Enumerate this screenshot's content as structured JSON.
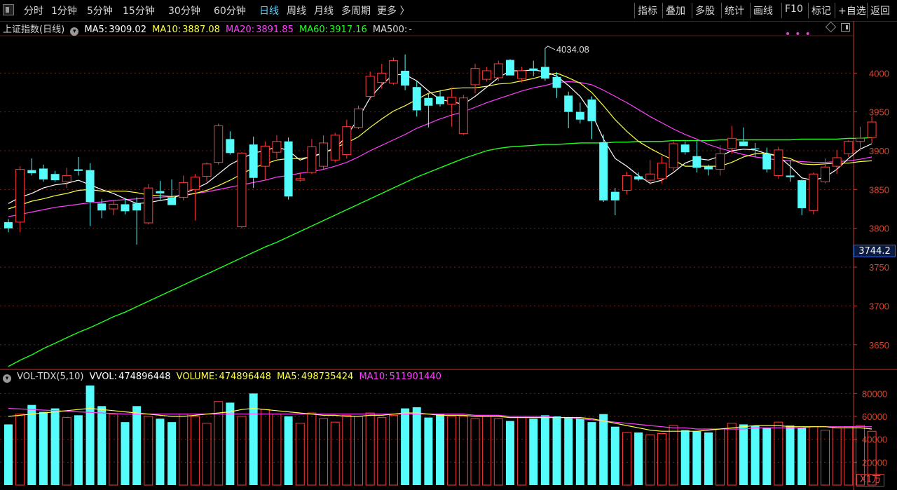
{
  "toolbar": {
    "periods": [
      "分时",
      "1分钟",
      "5分钟",
      "15分钟",
      "30分钟",
      "60分钟",
      "日线",
      "周线",
      "月线",
      "多周期",
      "更多 〉"
    ],
    "active_period": "日线",
    "right_items": [
      "指标",
      "叠加",
      "多股",
      "统计",
      "画线",
      "F10",
      "标记",
      "+自选",
      "返回"
    ]
  },
  "main_legend": {
    "name": "上证指数(日线)",
    "ma5_label": "MA5:",
    "ma5": "3909.02",
    "ma10_label": "MA10:",
    "ma10": "3887.08",
    "ma20_label": "MA20:",
    "ma20": "3891.85",
    "ma60_label": "MA60:",
    "ma60": "3917.16",
    "ma500_label": "MA500:",
    "ma500": "-"
  },
  "volume_legend": {
    "name": "VOL-TDX(5,10)",
    "vvol_label": "VVOL:",
    "vvol": "474896448",
    "volume_label": "VOLUME:",
    "volume": "474896448",
    "ma5_label": "MA5:",
    "ma5": "498735424",
    "ma10_label": "MA10:",
    "ma10": "511901440"
  },
  "price_tag": "3744.2",
  "unit_label": "X1万",
  "colors": {
    "up": "#ff3b3b",
    "down": "#54fcfc",
    "ma5": "#ffffff",
    "ma10": "#ffff40",
    "ma20": "#ff40ff",
    "ma60": "#20ff20",
    "axis": "#c8382c",
    "text_axis": "#d8442c"
  },
  "chart_data": {
    "type": "candlestick",
    "title": "上证指数(日线)",
    "price_axis": {
      "ticks": [
        3650,
        3700,
        3750,
        3800,
        3850,
        3900,
        3950,
        4000
      ],
      "range": [
        3620,
        4040
      ]
    },
    "volume_axis": {
      "ticks": [
        20000,
        40000,
        60000,
        80000
      ],
      "range": [
        0,
        90000
      ],
      "unit": "X1万"
    },
    "annotation_high": "4034.08",
    "candles": [
      {
        "o": 3808,
        "h": 3812,
        "l": 3795,
        "c": 3800,
        "v": 53000
      },
      {
        "o": 3808,
        "h": 3880,
        "l": 3795,
        "c": 3876,
        "v": 62000
      },
      {
        "o": 3875,
        "h": 3890,
        "l": 3868,
        "c": 3871,
        "v": 70000
      },
      {
        "o": 3877,
        "h": 3882,
        "l": 3860,
        "c": 3863,
        "v": 64000
      },
      {
        "o": 3870,
        "h": 3874,
        "l": 3860,
        "c": 3862,
        "v": 67000
      },
      {
        "o": 3860,
        "h": 3878,
        "l": 3852,
        "c": 3868,
        "v": 59000
      },
      {
        "o": 3876,
        "h": 3892,
        "l": 3868,
        "c": 3874,
        "v": 61000
      },
      {
        "o": 3875,
        "h": 3884,
        "l": 3803,
        "c": 3834,
        "v": 87000
      },
      {
        "o": 3832,
        "h": 3838,
        "l": 3813,
        "c": 3823,
        "v": 69000
      },
      {
        "o": 3825,
        "h": 3835,
        "l": 3817,
        "c": 3831,
        "v": 62000
      },
      {
        "o": 3831,
        "h": 3838,
        "l": 3818,
        "c": 3822,
        "v": 55000
      },
      {
        "o": 3832,
        "h": 3840,
        "l": 3779,
        "c": 3823,
        "v": 69000
      },
      {
        "o": 3807,
        "h": 3857,
        "l": 3805,
        "c": 3852,
        "v": 60000
      },
      {
        "o": 3848,
        "h": 3861,
        "l": 3837,
        "c": 3845,
        "v": 58000
      },
      {
        "o": 3840,
        "h": 3863,
        "l": 3830,
        "c": 3830,
        "v": 55000
      },
      {
        "o": 3840,
        "h": 3868,
        "l": 3836,
        "c": 3859,
        "v": 62000
      },
      {
        "o": 3850,
        "h": 3870,
        "l": 3810,
        "c": 3866,
        "v": 60000
      },
      {
        "o": 3867,
        "h": 3885,
        "l": 3860,
        "c": 3883,
        "v": 54000
      },
      {
        "o": 3885,
        "h": 3935,
        "l": 3882,
        "c": 3932,
        "v": 73000
      },
      {
        "o": 3915,
        "h": 3925,
        "l": 3895,
        "c": 3897,
        "v": 72000
      },
      {
        "o": 3802,
        "h": 3898,
        "l": 3800,
        "c": 3897,
        "v": 60000
      },
      {
        "o": 3908,
        "h": 3918,
        "l": 3852,
        "c": 3865,
        "v": 80000
      },
      {
        "o": 3880,
        "h": 3912,
        "l": 3862,
        "c": 3906,
        "v": 66000
      },
      {
        "o": 3898,
        "h": 3920,
        "l": 3890,
        "c": 3912,
        "v": 62000
      },
      {
        "o": 3912,
        "h": 3917,
        "l": 3837,
        "c": 3841,
        "v": 60000
      },
      {
        "o": 3862,
        "h": 3872,
        "l": 3860,
        "c": 3864,
        "v": 54000
      },
      {
        "o": 3872,
        "h": 3915,
        "l": 3870,
        "c": 3905,
        "v": 63000
      },
      {
        "o": 3880,
        "h": 3920,
        "l": 3876,
        "c": 3910,
        "v": 58000
      },
      {
        "o": 3888,
        "h": 3923,
        "l": 3885,
        "c": 3920,
        "v": 55000
      },
      {
        "o": 3895,
        "h": 3940,
        "l": 3890,
        "c": 3931,
        "v": 61000
      },
      {
        "o": 3930,
        "h": 3958,
        "l": 3928,
        "c": 3954,
        "v": 60000
      },
      {
        "o": 3970,
        "h": 4002,
        "l": 3966,
        "c": 3996,
        "v": 63000
      },
      {
        "o": 3988,
        "h": 4012,
        "l": 3980,
        "c": 4000,
        "v": 59000
      },
      {
        "o": 3987,
        "h": 4020,
        "l": 3985,
        "c": 4016,
        "v": 61000
      },
      {
        "o": 4003,
        "h": 4024,
        "l": 3978,
        "c": 3984,
        "v": 67000
      },
      {
        "o": 3982,
        "h": 3990,
        "l": 3944,
        "c": 3952,
        "v": 68000
      },
      {
        "o": 3968,
        "h": 3974,
        "l": 3930,
        "c": 3958,
        "v": 59000
      },
      {
        "o": 3970,
        "h": 3978,
        "l": 3957,
        "c": 3960,
        "v": 62000
      },
      {
        "o": 3960,
        "h": 3981,
        "l": 3931,
        "c": 3969,
        "v": 60000
      },
      {
        "o": 3922,
        "h": 3972,
        "l": 3920,
        "c": 3968,
        "v": 60000
      },
      {
        "o": 3985,
        "h": 4012,
        "l": 3974,
        "c": 4006,
        "v": 58000
      },
      {
        "o": 3992,
        "h": 4008,
        "l": 3989,
        "c": 4003,
        "v": 60000
      },
      {
        "o": 3994,
        "h": 4016,
        "l": 3990,
        "c": 4012,
        "v": 58000
      },
      {
        "o": 4017,
        "h": 4018,
        "l": 3997,
        "c": 3997,
        "v": 56000
      },
      {
        "o": 3993,
        "h": 4008,
        "l": 3988,
        "c": 4003,
        "v": 60000
      },
      {
        "o": 4006,
        "h": 4016,
        "l": 3996,
        "c": 4003,
        "v": 58000
      },
      {
        "o": 4008,
        "h": 4032,
        "l": 3990,
        "c": 3993,
        "v": 61000
      },
      {
        "o": 3995,
        "h": 4001,
        "l": 3968,
        "c": 3981,
        "v": 60000
      },
      {
        "o": 3971,
        "h": 3976,
        "l": 3929,
        "c": 3950,
        "v": 59000
      },
      {
        "o": 3950,
        "h": 3962,
        "l": 3935,
        "c": 3940,
        "v": 58000
      },
      {
        "o": 3966,
        "h": 3970,
        "l": 3915,
        "c": 3938,
        "v": 55000
      },
      {
        "o": 3911,
        "h": 3921,
        "l": 3834,
        "c": 3836,
        "v": 62000
      },
      {
        "o": 3847,
        "h": 3852,
        "l": 3817,
        "c": 3836,
        "v": 51000
      },
      {
        "o": 3849,
        "h": 3873,
        "l": 3844,
        "c": 3868,
        "v": 46000
      },
      {
        "o": 3867,
        "h": 3872,
        "l": 3861,
        "c": 3863,
        "v": 46000
      },
      {
        "o": 3862,
        "h": 3888,
        "l": 3856,
        "c": 3870,
        "v": 44000
      },
      {
        "o": 3864,
        "h": 3893,
        "l": 3858,
        "c": 3884,
        "v": 45000
      },
      {
        "o": 3878,
        "h": 3912,
        "l": 3874,
        "c": 3909,
        "v": 52000
      },
      {
        "o": 3908,
        "h": 3912,
        "l": 3895,
        "c": 3898,
        "v": 48000
      },
      {
        "o": 3893,
        "h": 3912,
        "l": 3872,
        "c": 3878,
        "v": 47000
      },
      {
        "o": 3880,
        "h": 3882,
        "l": 3868,
        "c": 3876,
        "v": 46000
      },
      {
        "o": 3876,
        "h": 3907,
        "l": 3868,
        "c": 3896,
        "v": 49000
      },
      {
        "o": 3903,
        "h": 3932,
        "l": 3896,
        "c": 3916,
        "v": 54000
      },
      {
        "o": 3912,
        "h": 3930,
        "l": 3906,
        "c": 3906,
        "v": 53000
      },
      {
        "o": 3903,
        "h": 3910,
        "l": 3892,
        "c": 3902,
        "v": 52000
      },
      {
        "o": 3896,
        "h": 3904,
        "l": 3872,
        "c": 3876,
        "v": 50000
      },
      {
        "o": 3868,
        "h": 3905,
        "l": 3864,
        "c": 3901,
        "v": 55000
      },
      {
        "o": 3868,
        "h": 3888,
        "l": 3860,
        "c": 3866,
        "v": 52000
      },
      {
        "o": 3862,
        "h": 3863,
        "l": 3817,
        "c": 3826,
        "v": 50000
      },
      {
        "o": 3823,
        "h": 3872,
        "l": 3818,
        "c": 3870,
        "v": 51000
      },
      {
        "o": 3860,
        "h": 3890,
        "l": 3858,
        "c": 3879,
        "v": 48000
      },
      {
        "o": 3880,
        "h": 3901,
        "l": 3870,
        "c": 3891,
        "v": 50000
      },
      {
        "o": 3896,
        "h": 3914,
        "l": 3892,
        "c": 3912,
        "v": 51000
      },
      {
        "o": 3912,
        "h": 3931,
        "l": 3900,
        "c": 3916,
        "v": 52000
      },
      {
        "o": 3917,
        "h": 3944,
        "l": 3910,
        "c": 3937,
        "v": 47000
      }
    ],
    "ma5": [
      3832,
      3840,
      3845,
      3852,
      3856,
      3858,
      3862,
      3856,
      3850,
      3845,
      3838,
      3832,
      3833,
      3836,
      3838,
      3845,
      3851,
      3858,
      3870,
      3882,
      3890,
      3897,
      3900,
      3905,
      3900,
      3888,
      3893,
      3897,
      3903,
      3919,
      3942,
      3968,
      3985,
      3998,
      3998,
      3990,
      3977,
      3966,
      3963,
      3960,
      3970,
      3982,
      3994,
      4003,
      4003,
      4004,
      4002,
      3996,
      3984,
      3970,
      3948,
      3915,
      3890,
      3880,
      3868,
      3858,
      3862,
      3872,
      3884,
      3890,
      3888,
      3893,
      3900,
      3902,
      3901,
      3896,
      3893,
      3880,
      3865,
      3862,
      3866,
      3876,
      3890,
      3902,
      3909
    ],
    "ma10": [
      3825,
      3830,
      3835,
      3838,
      3842,
      3845,
      3849,
      3850,
      3848,
      3848,
      3848,
      3846,
      3843,
      3842,
      3841,
      3842,
      3845,
      3849,
      3855,
      3862,
      3870,
      3878,
      3883,
      3888,
      3890,
      3890,
      3892,
      3897,
      3904,
      3910,
      3918,
      3930,
      3941,
      3951,
      3958,
      3966,
      3974,
      3977,
      3980,
      3981,
      3981,
      3983,
      3986,
      3987,
      3990,
      3993,
      3997,
      4000,
      3994,
      3987,
      3975,
      3958,
      3940,
      3925,
      3912,
      3903,
      3895,
      3888,
      3880,
      3880,
      3880,
      3880,
      3885,
      3892,
      3896,
      3897,
      3893,
      3890,
      3883,
      3882,
      3883,
      3884,
      3884,
      3886,
      3887
    ],
    "ma20": [
      3815,
      3818,
      3821,
      3824,
      3827,
      3829,
      3831,
      3833,
      3834,
      3836,
      3837,
      3838,
      3839,
      3840,
      3841,
      3843,
      3845,
      3847,
      3850,
      3853,
      3856,
      3859,
      3862,
      3866,
      3868,
      3871,
      3873,
      3876,
      3880,
      3885,
      3892,
      3900,
      3907,
      3914,
      3921,
      3929,
      3935,
      3941,
      3946,
      3950,
      3956,
      3962,
      3967,
      3972,
      3977,
      3981,
      3984,
      3988,
      3989,
      3988,
      3985,
      3978,
      3970,
      3962,
      3953,
      3944,
      3936,
      3928,
      3921,
      3915,
      3908,
      3903,
      3899,
      3895,
      3892,
      3890,
      3888,
      3887,
      3886,
      3885,
      3885,
      3886,
      3887,
      3889,
      3892
    ],
    "ma60": [
      3622,
      3630,
      3637,
      3645,
      3652,
      3659,
      3666,
      3672,
      3679,
      3686,
      3692,
      3699,
      3706,
      3713,
      3720,
      3727,
      3734,
      3741,
      3748,
      3755,
      3762,
      3769,
      3776,
      3782,
      3789,
      3796,
      3803,
      3810,
      3817,
      3824,
      3831,
      3838,
      3845,
      3852,
      3859,
      3866,
      3872,
      3878,
      3884,
      3890,
      3895,
      3900,
      3903,
      3905,
      3906,
      3907,
      3908,
      3908,
      3909,
      3910,
      3910,
      3910,
      3911,
      3911,
      3912,
      3912,
      3912,
      3913,
      3913,
      3913,
      3913,
      3914,
      3914,
      3914,
      3914,
      3914,
      3914,
      3914,
      3915,
      3915,
      3915,
      3915,
      3916,
      3916,
      3917
    ],
    "vol_ma5": [
      60000,
      61000,
      62000,
      63000,
      64000,
      65000,
      66000,
      67000,
      66000,
      65000,
      64000,
      63000,
      62000,
      61000,
      60000,
      60000,
      61000,
      62000,
      63000,
      64000,
      66000,
      67000,
      66000,
      65000,
      64000,
      63000,
      62000,
      61000,
      61000,
      60000,
      60000,
      61000,
      61000,
      62000,
      63000,
      63000,
      62000,
      61000,
      61000,
      61000,
      60000,
      60000,
      60000,
      59000,
      59000,
      59000,
      59000,
      59000,
      59000,
      59000,
      58000,
      56000,
      54000,
      52000,
      50000,
      48000,
      47000,
      47000,
      47000,
      47000,
      48000,
      49000,
      50000,
      51000,
      52000,
      52000,
      52000,
      51000,
      51000,
      51000,
      51000,
      50000,
      50000,
      50000,
      49000
    ],
    "vol_ma10": [
      67000,
      66500,
      66000,
      65500,
      65000,
      64500,
      64000,
      63500,
      63000,
      62500,
      62000,
      62000,
      62000,
      62000,
      62000,
      62000,
      62000,
      62000,
      62000,
      62000,
      62000,
      62000,
      62000,
      62000,
      62000,
      62000,
      62000,
      62000,
      62000,
      62000,
      62000,
      62000,
      62000,
      62000,
      62000,
      62000,
      62000,
      62000,
      62000,
      62000,
      61000,
      61000,
      61000,
      60000,
      60000,
      60000,
      60000,
      59000,
      59000,
      58000,
      57000,
      56000,
      55000,
      54000,
      53000,
      52000,
      51000,
      50000,
      50000,
      49000,
      49000,
      49000,
      49000,
      49000,
      50000,
      50000,
      50000,
      50000,
      50000,
      51000,
      51000,
      51000,
      51000,
      51000,
      51000
    ]
  }
}
